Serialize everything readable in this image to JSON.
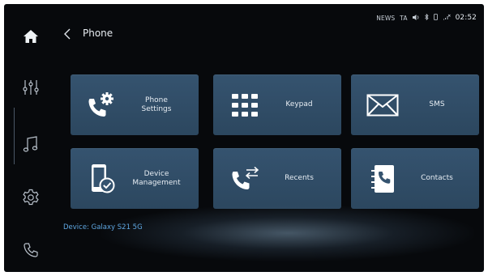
{
  "header": {
    "title": "Phone"
  },
  "status_bar": {
    "radio": "NEWS",
    "ta": "TA",
    "clock": "02:52"
  },
  "sidebar": {
    "items": [
      {
        "icon": "home-icon"
      },
      {
        "icon": "equalizer-icon"
      },
      {
        "icon": "music-note-icon"
      },
      {
        "icon": "gear-icon"
      },
      {
        "icon": "phone-icon"
      }
    ]
  },
  "tiles": [
    {
      "label": "Phone\nSettings",
      "icon": "phone-settings-icon"
    },
    {
      "label": "Keypad",
      "icon": "keypad-icon"
    },
    {
      "label": "SMS",
      "icon": "envelope-icon"
    },
    {
      "label": "Device\nManagement",
      "icon": "device-check-icon"
    },
    {
      "label": "Recents",
      "icon": "phone-arrows-icon"
    },
    {
      "label": "Contacts",
      "icon": "contacts-book-icon"
    }
  ],
  "device": {
    "text": "Device: Galaxy S21 5G"
  },
  "colors": {
    "tile": "#35536f",
    "accent": "#5fa7e2",
    "background": "#07090c"
  }
}
